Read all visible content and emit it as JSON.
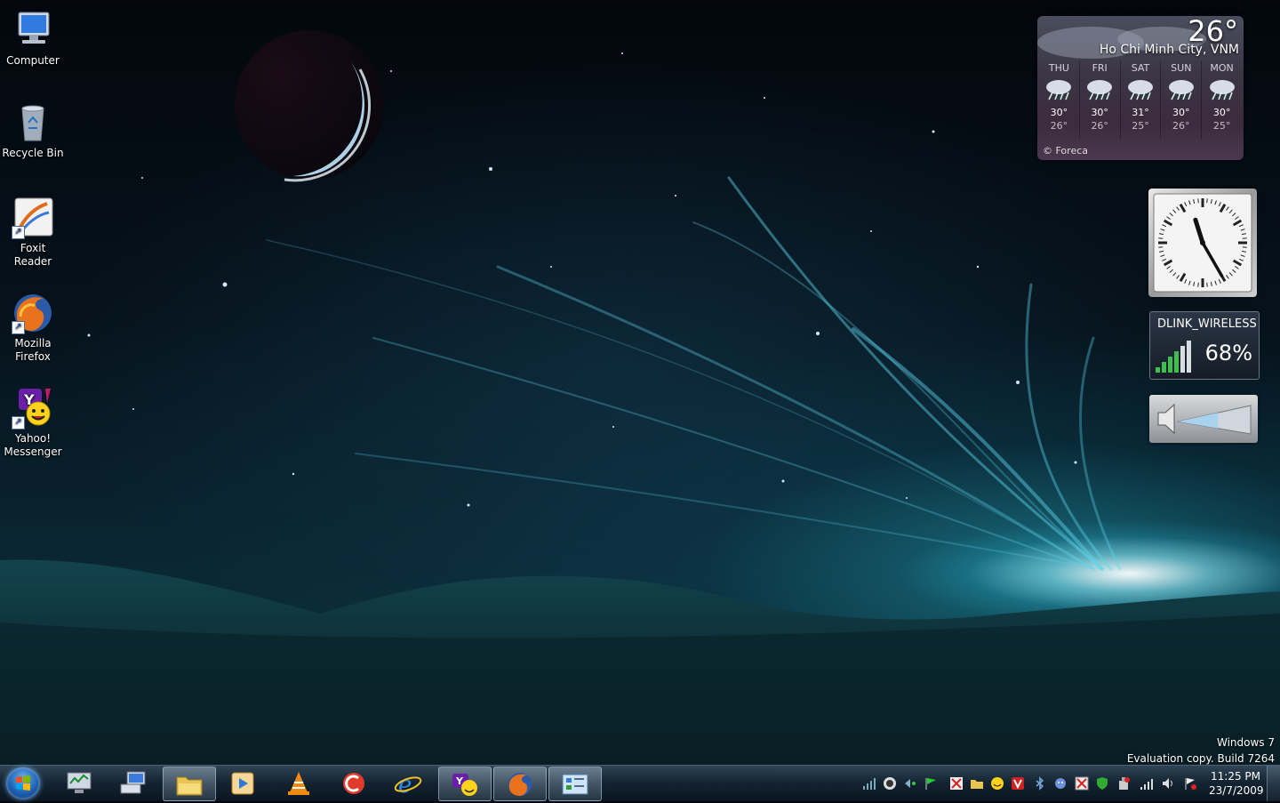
{
  "desktop": {
    "icons": [
      {
        "label": "Computer"
      },
      {
        "label": "Recycle Bin"
      },
      {
        "label": "Foxit Reader"
      },
      {
        "label": "Mozilla Firefox"
      },
      {
        "label": "Yahoo! Messenger"
      }
    ]
  },
  "gadgets": {
    "weather": {
      "temperature": "26°",
      "city": "Ho Chi Minh City, VNM",
      "days": [
        {
          "name": "THU",
          "high": "30°",
          "low": "26°"
        },
        {
          "name": "FRI",
          "high": "30°",
          "low": "26°"
        },
        {
          "name": "SAT",
          "high": "31°",
          "low": "25°"
        },
        {
          "name": "SUN",
          "high": "30°",
          "low": "26°"
        },
        {
          "name": "MON",
          "high": "30°",
          "low": "25°"
        }
      ],
      "credit": "© Foreca"
    },
    "clock": {
      "time_shown": "11:25"
    },
    "wifi": {
      "ssid": "DLINK_WIRELESS",
      "signal": "68%",
      "signal_fraction": 0.68
    },
    "volume": {
      "level_fraction": 0.55
    }
  },
  "watermark": {
    "line1": "Windows 7",
    "line2": "Evaluation copy. Build 7264"
  },
  "taskbar": {
    "clock_time": "11:25 PM",
    "clock_date": "23/7/2009",
    "pinned": [
      "task-manager",
      "network",
      "file-explorer",
      "media-player",
      "vlc",
      "ccleaner",
      "internet-explorer",
      "yahoo-messenger",
      "firefox",
      "control-panel"
    ]
  },
  "colors": {
    "accent": "#2fd0e6",
    "taskbar": "#142330"
  }
}
